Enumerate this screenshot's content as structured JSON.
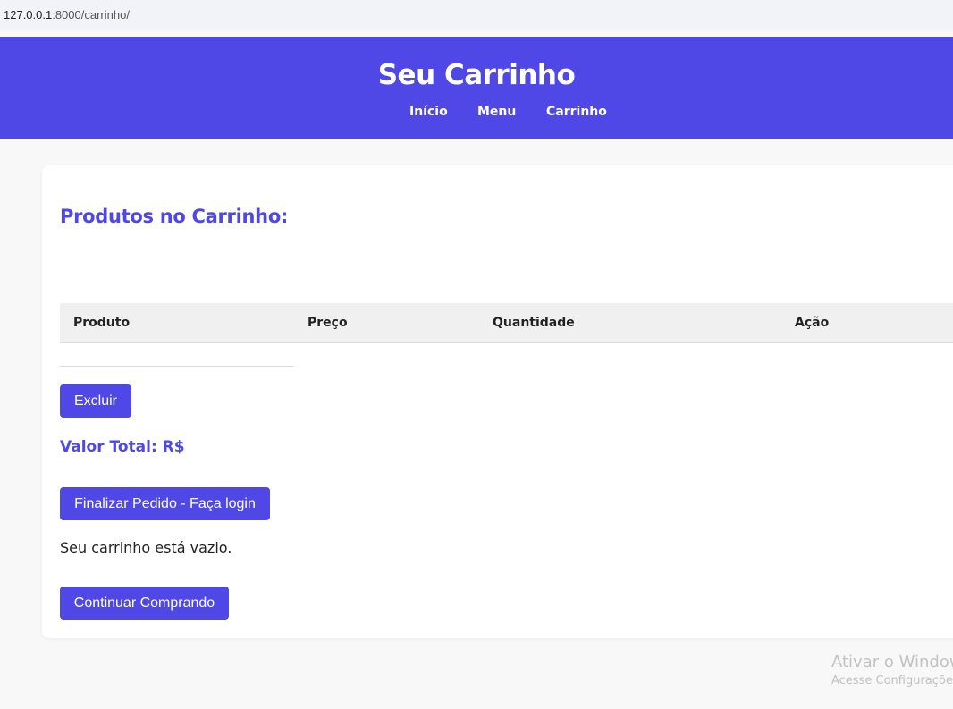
{
  "browser": {
    "url_host": "127.0.0.1",
    "url_rest": ":8000/carrinho/"
  },
  "header": {
    "title": "Seu Carrinho",
    "nav": [
      "Início",
      "Menu",
      "Carrinho"
    ]
  },
  "cart": {
    "heading": "Produtos no Carrinho:",
    "columns": [
      "Produto",
      "Preço",
      "Quantidade",
      "Ação"
    ],
    "remove_label": "Excluir",
    "total_label": "Valor Total: R$",
    "checkout_label": "Finalizar Pedido - Faça login",
    "empty_message": "Seu carrinho está vazio.",
    "continue_label": "Continuar Comprando"
  },
  "watermark": {
    "line1": "Ativar o Windows",
    "line2": "Acesse Configurações"
  },
  "colors": {
    "accent": "#4f47e6",
    "page_bg": "#f8f8f8",
    "table_head_bg": "#f0f0f0"
  }
}
